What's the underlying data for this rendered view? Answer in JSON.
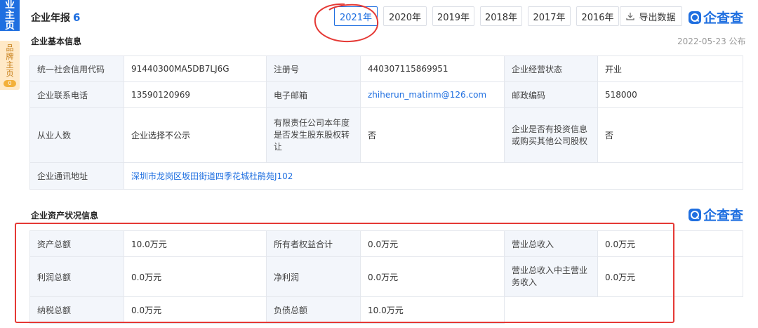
{
  "sidebar": {
    "primary_tab": "业\n主\n页",
    "secondary_tab": "品\n牌\n主\n页",
    "secondary_badge": "0"
  },
  "header": {
    "title": "企业年报",
    "count": "6"
  },
  "year_tabs": [
    "2021年",
    "2020年",
    "2019年",
    "2018年",
    "2017年",
    "2016年"
  ],
  "active_year": "2021年",
  "export_label": "导出数据",
  "brand": "企查查",
  "basic_info": {
    "title": "企业基本信息",
    "published": "2022-05-23 公布",
    "rows": [
      [
        {
          "label": "统一社会信用代码",
          "value": "91440300MA5DB7LJ6G"
        },
        {
          "label": "注册号",
          "value": "440307115869951"
        },
        {
          "label": "企业经营状态",
          "value": "开业"
        }
      ],
      [
        {
          "label": "企业联系电话",
          "value": "13590120969"
        },
        {
          "label": "电子邮箱",
          "value": "zhiherun_matinm@126.com"
        },
        {
          "label": "邮政编码",
          "value": "518000"
        }
      ],
      [
        {
          "label": "从业人数",
          "value": "企业选择不公示"
        },
        {
          "label": "有限责任公司本年度是否发生股东股权转让",
          "value": "否"
        },
        {
          "label": "企业是否有投资信息或购买其他公司股权",
          "value": "否"
        }
      ]
    ],
    "address_label": "企业通讯地址",
    "address_value": "深圳市龙岗区坂田街道四季花城杜鹃苑J102"
  },
  "asset_info": {
    "title": "企业资产状况信息",
    "rows": [
      [
        {
          "label": "资产总额",
          "value": "10.0万元"
        },
        {
          "label": "所有者权益合计",
          "value": "0.0万元"
        },
        {
          "label": "营业总收入",
          "value": "0.0万元"
        }
      ],
      [
        {
          "label": "利润总额",
          "value": "0.0万元"
        },
        {
          "label": "净利润",
          "value": "0.0万元"
        },
        {
          "label": "营业总收入中主营业务收入",
          "value": "0.0万元"
        }
      ],
      [
        {
          "label": "纳税总额",
          "value": "0.0万元"
        },
        {
          "label": "负债总额",
          "value": "10.0万元"
        }
      ]
    ]
  },
  "colors": {
    "accent": "#1f6fe0",
    "annotation": "#e53935",
    "label_bg": "#f3f6fb",
    "border": "#e4e7ed"
  },
  "icons": [
    "download-icon",
    "qichacha-logo-icon"
  ]
}
